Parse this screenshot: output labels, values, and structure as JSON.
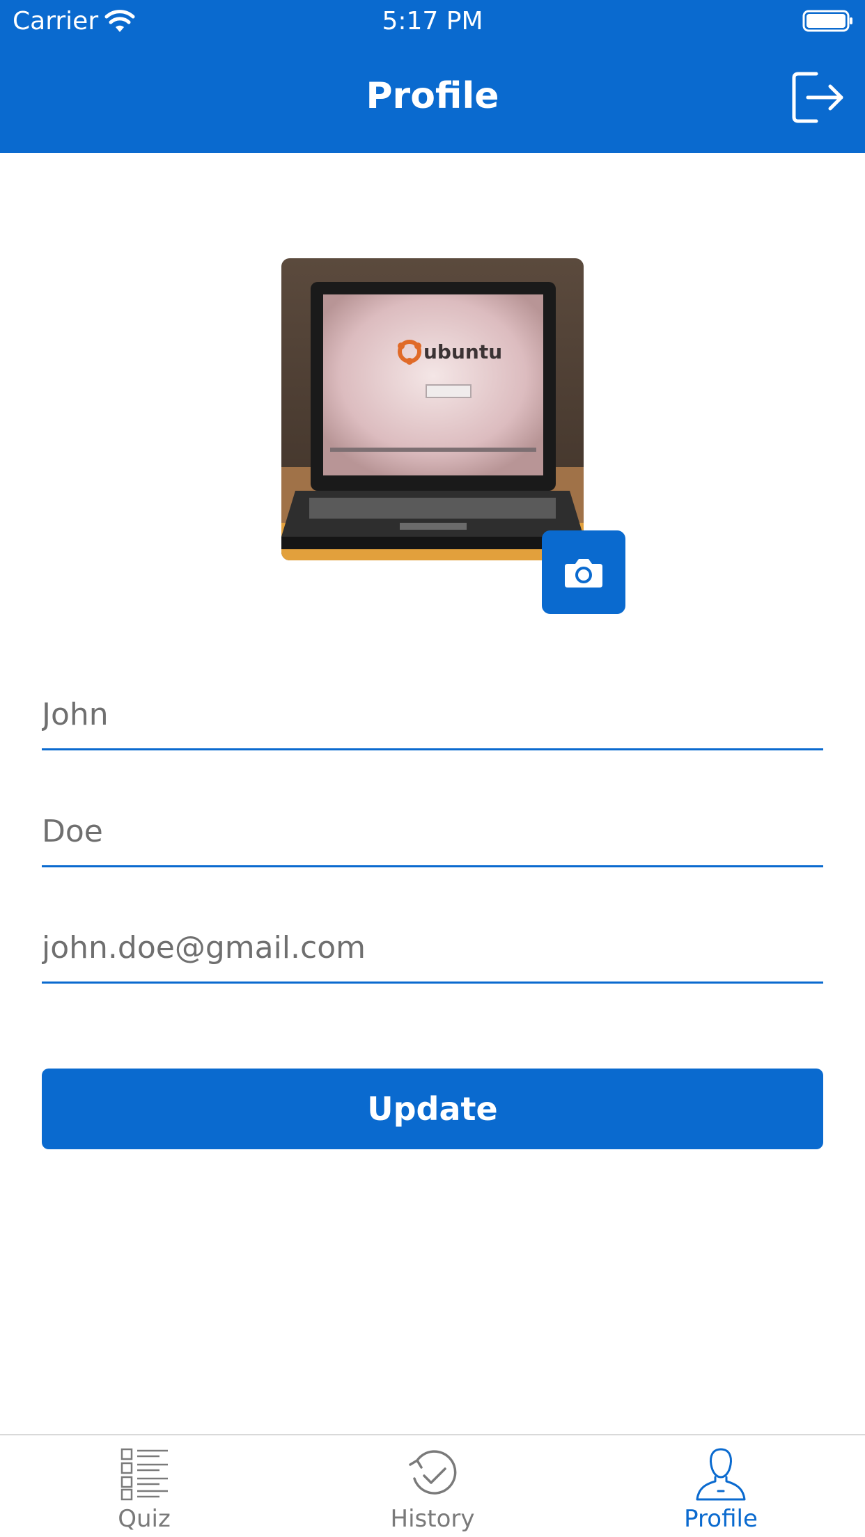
{
  "colors": {
    "brand": "#0a6acf",
    "tab_inactive": "#7a7a7a",
    "input_text": "#6f6f6f"
  },
  "status_bar": {
    "carrier": "Carrier",
    "time": "5:17 PM",
    "wifi_icon": "wifi-icon",
    "battery_icon": "battery-icon"
  },
  "header": {
    "title": "Profile",
    "logout_icon": "logout-icon"
  },
  "profile": {
    "avatar": "laptop-photo",
    "camera_icon": "camera-icon",
    "first_name": "John",
    "last_name": "Doe",
    "email": "john.doe@gmail.com",
    "update_label": "Update"
  },
  "tabs": [
    {
      "label": "Quiz",
      "icon": "quiz-list-icon",
      "active": false
    },
    {
      "label": "History",
      "icon": "history-icon",
      "active": false
    },
    {
      "label": "Profile",
      "icon": "profile-icon",
      "active": true
    }
  ]
}
